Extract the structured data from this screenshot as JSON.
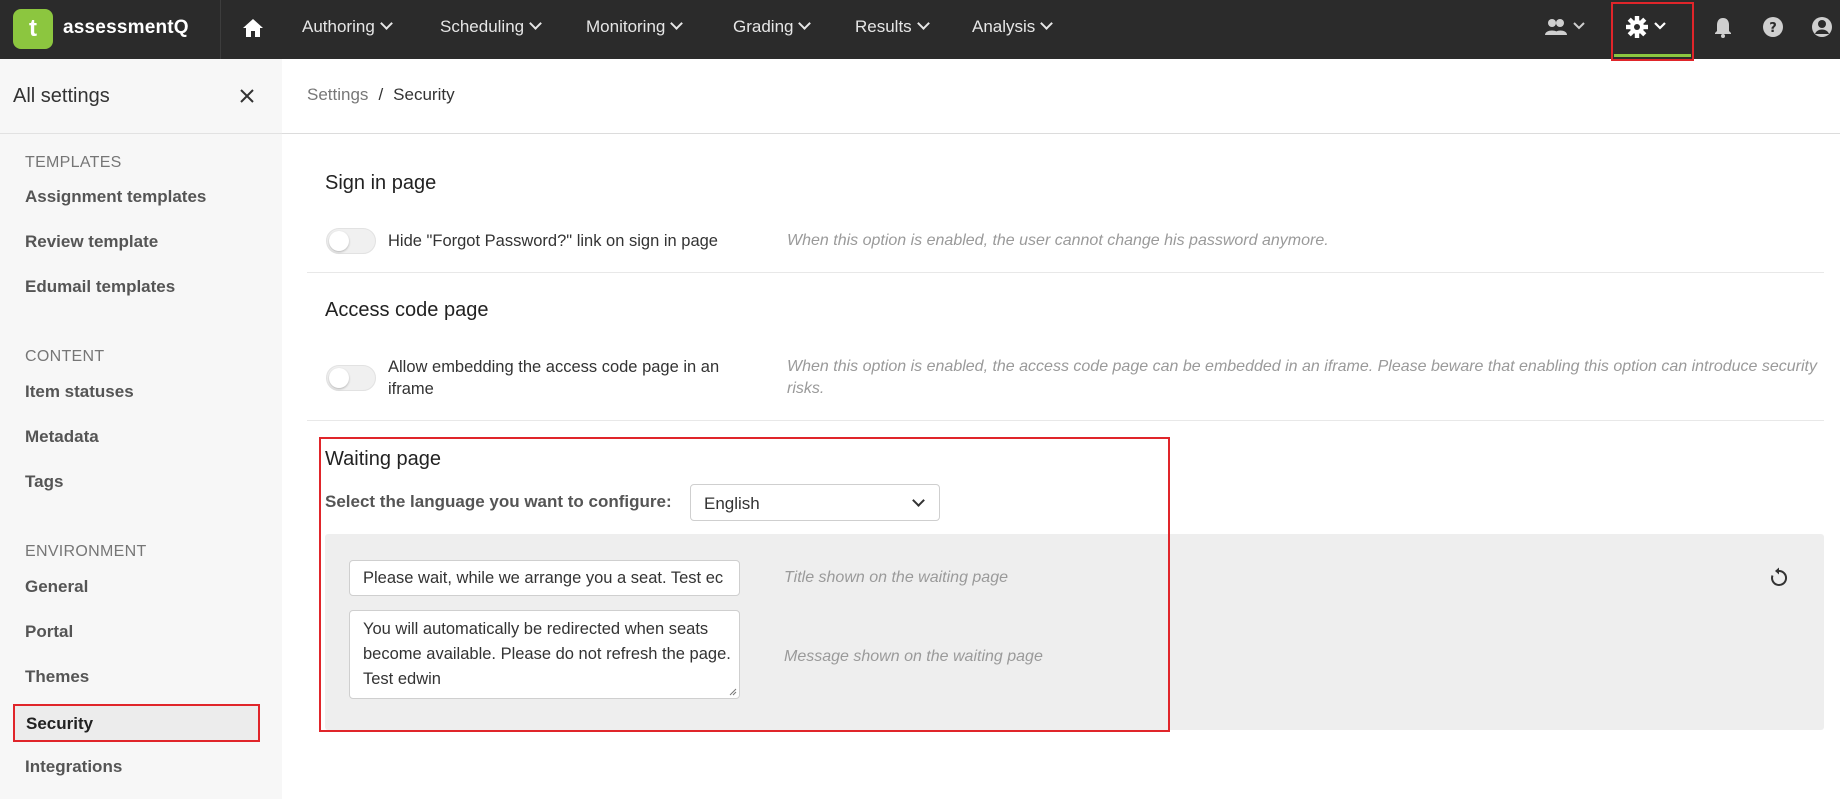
{
  "brand": {
    "name": "assessmentQ",
    "logo_letter": "t",
    "logo_color": "#8cc63f"
  },
  "nav": [
    {
      "label": "Authoring"
    },
    {
      "label": "Scheduling"
    },
    {
      "label": "Monitoring"
    },
    {
      "label": "Grading"
    },
    {
      "label": "Results"
    },
    {
      "label": "Analysis"
    }
  ],
  "sidebar": {
    "title": "All settings",
    "sections": [
      {
        "title": "TEMPLATES",
        "items": [
          "Assignment templates",
          "Review template",
          "Edumail templates"
        ]
      },
      {
        "title": "CONTENT",
        "items": [
          "Item statuses",
          "Metadata",
          "Tags"
        ]
      },
      {
        "title": "ENVIRONMENT",
        "items": [
          "General",
          "Portal",
          "Themes",
          "Security",
          "Integrations"
        ]
      }
    ],
    "active_item": "Security"
  },
  "breadcrumb": {
    "root": "Settings",
    "separator": "/",
    "current": "Security"
  },
  "sign_in": {
    "heading": "Sign in page",
    "option_label": "Hide \"Forgot Password?\" link on sign in page",
    "hint": "When this option is enabled, the user cannot change his password anymore."
  },
  "access_code": {
    "heading": "Access code page",
    "option_label": "Allow embedding the access code page in an iframe",
    "hint": "When this option is enabled, the access code page can be embedded in an iframe. Please beware that enabling this option can introduce security risks."
  },
  "waiting": {
    "heading": "Waiting page",
    "language_label": "Select the language you want to configure:",
    "language_value": "English",
    "title_value": "Please wait, while we arrange you a seat. Test ec",
    "title_hint": "Title shown on the waiting page",
    "message_value": "You will automatically be redirected when seats become available. Please do not refresh the page. Test edwin",
    "message_hint": "Message shown on the waiting page"
  },
  "colors": {
    "topbar": "#2b2b2b",
    "accent": "#8cc63f",
    "highlight": "#e0252a"
  }
}
